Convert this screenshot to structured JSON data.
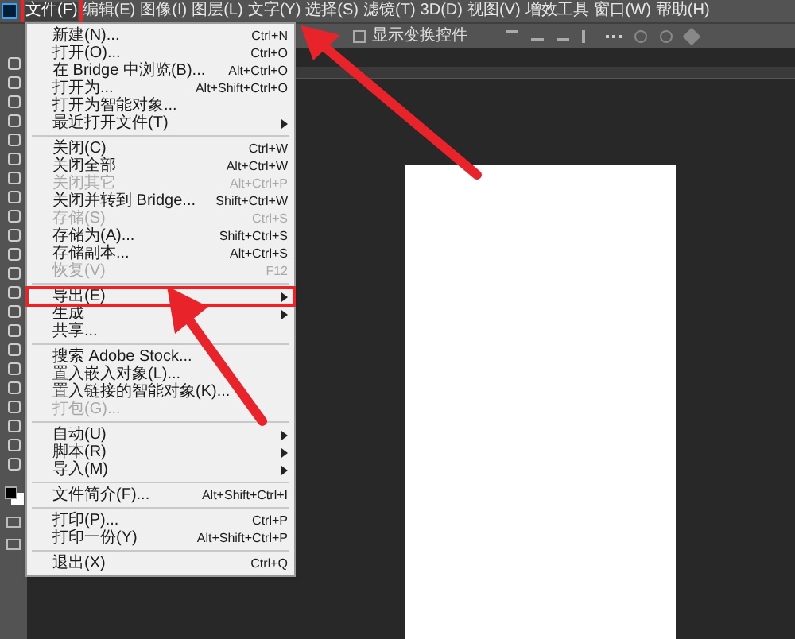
{
  "menubar": [
    {
      "label": "文件(F)",
      "selected": true
    },
    {
      "label": "编辑(E)",
      "selected": false
    },
    {
      "label": "图像(I)",
      "selected": false
    },
    {
      "label": "图层(L)",
      "selected": false
    },
    {
      "label": "文字(Y)",
      "selected": false
    },
    {
      "label": "选择(S)",
      "selected": false
    },
    {
      "label": "滤镜(T)",
      "selected": false
    },
    {
      "label": "3D(D)",
      "selected": false
    },
    {
      "label": "视图(V)",
      "selected": false
    },
    {
      "label": "增效工具",
      "selected": false
    },
    {
      "label": "窗口(W)",
      "selected": false
    },
    {
      "label": "帮助(H)",
      "selected": false
    }
  ],
  "options_bar": {
    "transform_label": "显示变换控件",
    "transform_checked": false
  },
  "file_menu": [
    {
      "kind": "item",
      "label": "新建(N)...",
      "shortcut": "Ctrl+N",
      "disabled": false,
      "submenu": false,
      "highlighted": false
    },
    {
      "kind": "item",
      "label": "打开(O)...",
      "shortcut": "Ctrl+O",
      "disabled": false,
      "submenu": false,
      "highlighted": false
    },
    {
      "kind": "item",
      "label": "在 Bridge 中浏览(B)...",
      "shortcut": "Alt+Ctrl+O",
      "disabled": false,
      "submenu": false,
      "highlighted": false
    },
    {
      "kind": "item",
      "label": "打开为...",
      "shortcut": "Alt+Shift+Ctrl+O",
      "disabled": false,
      "submenu": false,
      "highlighted": false
    },
    {
      "kind": "item",
      "label": "打开为智能对象...",
      "disabled": false,
      "submenu": false,
      "highlighted": false
    },
    {
      "kind": "item",
      "label": "最近打开文件(T)",
      "disabled": false,
      "submenu": true,
      "highlighted": false
    },
    {
      "kind": "separator"
    },
    {
      "kind": "item",
      "label": "关闭(C)",
      "shortcut": "Ctrl+W",
      "disabled": false,
      "submenu": false,
      "highlighted": false
    },
    {
      "kind": "item",
      "label": "关闭全部",
      "shortcut": "Alt+Ctrl+W",
      "disabled": false,
      "submenu": false,
      "highlighted": false
    },
    {
      "kind": "item",
      "label": "关闭其它",
      "shortcut": "Alt+Ctrl+P",
      "disabled": true,
      "submenu": false,
      "highlighted": false
    },
    {
      "kind": "item",
      "label": "关闭并转到 Bridge...",
      "shortcut": "Shift+Ctrl+W",
      "disabled": false,
      "submenu": false,
      "highlighted": false
    },
    {
      "kind": "item",
      "label": "存储(S)",
      "shortcut": "Ctrl+S",
      "disabled": true,
      "submenu": false,
      "highlighted": false
    },
    {
      "kind": "item",
      "label": "存储为(A)...",
      "shortcut": "Shift+Ctrl+S",
      "disabled": false,
      "submenu": false,
      "highlighted": false
    },
    {
      "kind": "item",
      "label": "存储副本...",
      "shortcut": "Alt+Ctrl+S",
      "disabled": false,
      "submenu": false,
      "highlighted": false
    },
    {
      "kind": "item",
      "label": "恢复(V)",
      "shortcut": "F12",
      "disabled": true,
      "submenu": false,
      "highlighted": false
    },
    {
      "kind": "separator"
    },
    {
      "kind": "item",
      "label": "导出(E)",
      "disabled": false,
      "submenu": true,
      "highlighted": true
    },
    {
      "kind": "item",
      "label": "生成",
      "disabled": false,
      "submenu": true,
      "highlighted": false
    },
    {
      "kind": "item",
      "label": "共享...",
      "disabled": false,
      "submenu": false,
      "highlighted": false
    },
    {
      "kind": "separator"
    },
    {
      "kind": "item",
      "label": "搜索 Adobe Stock...",
      "disabled": false,
      "submenu": false,
      "highlighted": false
    },
    {
      "kind": "item",
      "label": "置入嵌入对象(L)...",
      "disabled": false,
      "submenu": false,
      "highlighted": false
    },
    {
      "kind": "item",
      "label": "置入链接的智能对象(K)...",
      "disabled": false,
      "submenu": false,
      "highlighted": false
    },
    {
      "kind": "item",
      "label": "打包(G)...",
      "disabled": true,
      "submenu": false,
      "highlighted": false
    },
    {
      "kind": "separator"
    },
    {
      "kind": "item",
      "label": "自动(U)",
      "disabled": false,
      "submenu": true,
      "highlighted": false
    },
    {
      "kind": "item",
      "label": "脚本(R)",
      "disabled": false,
      "submenu": true,
      "highlighted": false
    },
    {
      "kind": "item",
      "label": "导入(M)",
      "disabled": false,
      "submenu": true,
      "highlighted": false
    },
    {
      "kind": "separator"
    },
    {
      "kind": "item",
      "label": "文件简介(F)...",
      "shortcut": "Alt+Shift+Ctrl+I",
      "disabled": false,
      "submenu": false,
      "highlighted": false
    },
    {
      "kind": "separator"
    },
    {
      "kind": "item",
      "label": "打印(P)...",
      "shortcut": "Ctrl+P",
      "disabled": false,
      "submenu": false,
      "highlighted": false
    },
    {
      "kind": "item",
      "label": "打印一份(Y)",
      "shortcut": "Alt+Shift+Ctrl+P",
      "disabled": false,
      "submenu": false,
      "highlighted": false
    },
    {
      "kind": "separator"
    },
    {
      "kind": "item",
      "label": "退出(X)",
      "shortcut": "Ctrl+Q",
      "disabled": false,
      "submenu": false,
      "highlighted": false
    }
  ]
}
